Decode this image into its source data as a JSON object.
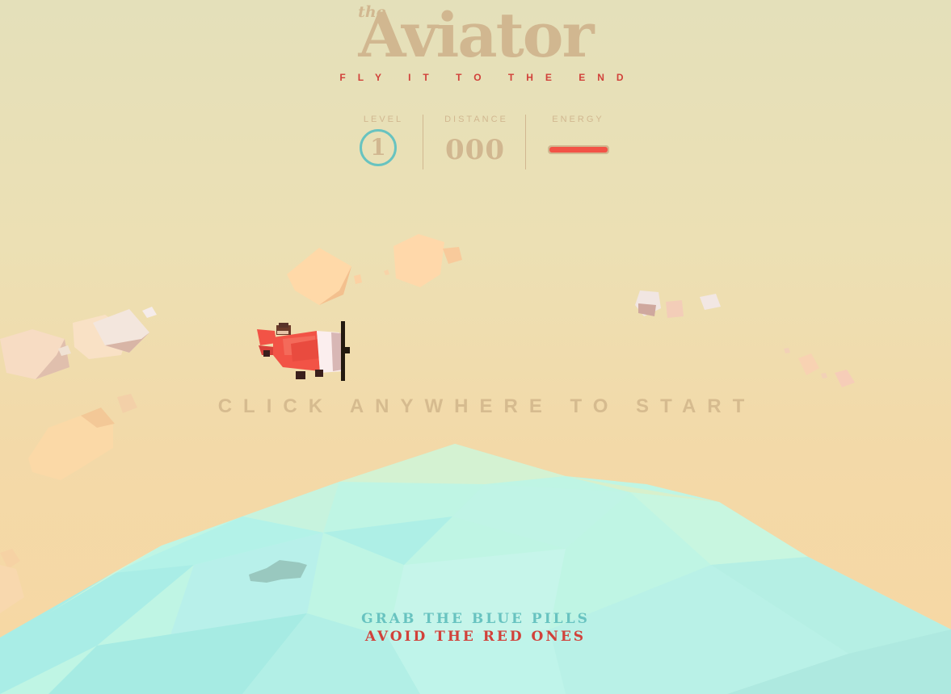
{
  "game": {
    "title_small": "the",
    "title_main": "Aviator",
    "subtitle": "FLY IT TO THE END"
  },
  "scoreboard": {
    "level_label": "LEVEL",
    "level_value": "1",
    "distance_label": "DISTANCE",
    "distance_value": "000",
    "energy_label": "ENERGY",
    "energy_level": 1.0
  },
  "start_message": "CLICK ANYWHERE TO START",
  "instructions": {
    "line1": "GRAB THE BLUE PILLS",
    "line2": "AVOID THE RED ONES"
  },
  "colors": {
    "accent": "#d1b790",
    "red": "#d1413a",
    "blue": "#68c3c0",
    "sea": "#b8f5e3"
  },
  "icons": {
    "player": "red-airplane-icon",
    "ground": "low-poly-sea-icon",
    "clouds": "cube-cloud-icon"
  }
}
